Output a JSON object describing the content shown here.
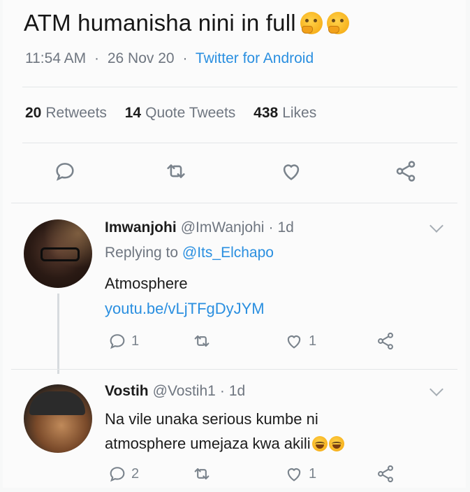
{
  "tweet": {
    "text": "ATM humanisha nini in full",
    "emoji": [
      "thinking-face",
      "thinking-face"
    ],
    "time": "11:54 AM",
    "date": "26 Nov 20",
    "separator": "·",
    "source": "Twitter for Android",
    "stats": {
      "retweets_count": "20",
      "retweets_label": "Retweets",
      "quotes_count": "14",
      "quotes_label": "Quote Tweets",
      "likes_count": "438",
      "likes_label": "Likes"
    }
  },
  "replies": [
    {
      "name": "Imwanjohi",
      "handle": "@ImWanjohi",
      "age": "1d",
      "replying_prefix": "Replying to",
      "replying_to": "@Its_Elchapo",
      "text_line1": "Atmosphere",
      "link": "youtu.be/vLjTFgDyJYM",
      "reply_count": "1",
      "retweet_count": "",
      "like_count": "1"
    },
    {
      "name": "Vostih",
      "handle": "@Vostih1",
      "age": "1d",
      "text_line1": "Na vile unaka serious kumbe ni",
      "text_line2": "atmosphere umejaza kwa akili",
      "emoji": [
        "face-with-tears-of-joy",
        "face-with-tears-of-joy"
      ],
      "reply_count": "2",
      "retweet_count": "",
      "like_count": "1"
    }
  ],
  "colors": {
    "link": "#2a8fe0",
    "muted": "#6f7680",
    "icon": "#7a838c"
  }
}
